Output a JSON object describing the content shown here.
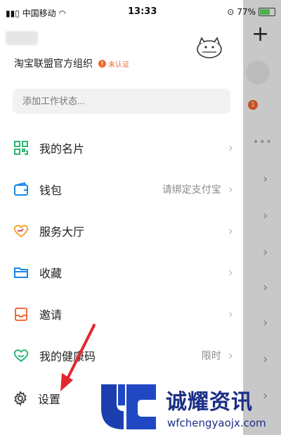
{
  "status_bar": {
    "carrier": "中国移动",
    "time": "13:33",
    "battery": "77%"
  },
  "drawer": {
    "org_name": "淘宝联盟官方组织",
    "verify_badge": "未认证",
    "status_placeholder": "添加工作状态...",
    "menu": [
      {
        "label": "我的名片",
        "extra": "",
        "icon": "qr-code-icon",
        "color": "#2bb673"
      },
      {
        "label": "钱包",
        "extra": "请绑定支付宝",
        "icon": "wallet-icon",
        "color": "#1a86e6"
      },
      {
        "label": "服务大厅",
        "extra": "",
        "icon": "heart-service-icon",
        "color": "#f2a531"
      },
      {
        "label": "收藏",
        "extra": "",
        "icon": "folder-icon",
        "color": "#1a86e6"
      },
      {
        "label": "邀请",
        "extra": "",
        "icon": "invite-icon",
        "color": "#f26b3a"
      },
      {
        "label": "我的健康码",
        "extra": "限时",
        "icon": "health-heart-icon",
        "color": "#2bb673"
      }
    ],
    "settings_label": "设置"
  },
  "watermark": {
    "name": "诚耀资讯",
    "url": "wfchengyaojx.com"
  },
  "background": {
    "badge_count": "1"
  }
}
